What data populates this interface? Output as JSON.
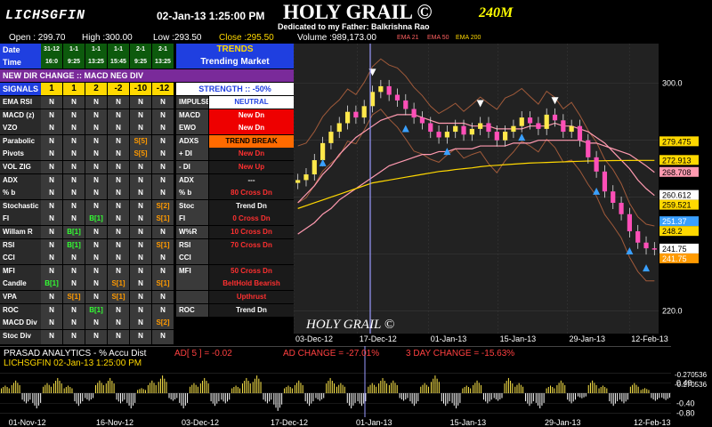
{
  "header": {
    "ticker": "LICHSGFIN",
    "datetime": "02-Jan-13 1:25:00 PM",
    "brand": "HOLY GRAIL ©",
    "timeframe": "240M",
    "dedication": "Dedicated to my Father: Balkrishna Rao"
  },
  "ohlc": {
    "open": "Open : 299.70",
    "high": "High :300.00",
    "low": "Low :293.50",
    "close": "Close :295.50",
    "volume": "Volume :989,173.00",
    "ema21": "EMA 21",
    "ema50": "EMA 50",
    "ema200": "EMA 200"
  },
  "panel": {
    "date_label": "Date",
    "time_label": "Time",
    "dates": [
      "31-12",
      "1-1",
      "1-1",
      "1-1",
      "2-1",
      "2-1"
    ],
    "times": [
      "16:0",
      "9:25",
      "13:25",
      "15:45",
      "9:25",
      "13:25"
    ],
    "trends_label": "TRENDS",
    "trend_status": "Trending Market",
    "dir_change": "NEW DIR CHANGE :: MACD NEG DIV",
    "signals_label": "SIGNALS",
    "signal_cols": [
      "1",
      "1",
      "2",
      "-2",
      "-10",
      "-12"
    ],
    "strength": "STRENGTH :: -50%",
    "rows": [
      {
        "name": "EMA RSI",
        "vals": [
          "N",
          "N",
          "N",
          "N",
          "N",
          "N"
        ]
      },
      {
        "name": "MACD (z)",
        "vals": [
          "N",
          "N",
          "N",
          "N",
          "N",
          "N"
        ]
      },
      {
        "name": "VZO",
        "vals": [
          "N",
          "N",
          "N",
          "N",
          "N",
          "N"
        ]
      },
      {
        "name": "Parabolic",
        "vals": [
          "N",
          "N",
          "N",
          "N",
          "S[5]",
          "N"
        ]
      },
      {
        "name": "Pivots",
        "vals": [
          "N",
          "N",
          "N",
          "N",
          "S[5]",
          "N"
        ]
      },
      {
        "name": "VOL ZIG",
        "vals": [
          "N",
          "N",
          "N",
          "N",
          "N",
          "N"
        ]
      },
      {
        "name": "ADX",
        "vals": [
          "N",
          "N",
          "N",
          "N",
          "N",
          "N"
        ]
      },
      {
        "name": "% b",
        "vals": [
          "N",
          "N",
          "N",
          "N",
          "N",
          "N"
        ]
      },
      {
        "name": "Stochastic",
        "vals": [
          "N",
          "N",
          "N",
          "N",
          "N",
          "S[2]"
        ]
      },
      {
        "name": "FI",
        "vals": [
          "N",
          "N",
          "B[1]",
          "N",
          "N",
          "S[1]"
        ]
      },
      {
        "name": "Willam R",
        "vals": [
          "N",
          "B[1]",
          "N",
          "N",
          "N",
          "N"
        ]
      },
      {
        "name": "RSI",
        "vals": [
          "N",
          "B[1]",
          "N",
          "N",
          "N",
          "S[1]"
        ]
      },
      {
        "name": "CCI",
        "vals": [
          "N",
          "N",
          "N",
          "N",
          "N",
          "N"
        ]
      },
      {
        "name": "MFI",
        "vals": [
          "N",
          "N",
          "N",
          "N",
          "N",
          "N"
        ]
      },
      {
        "name": "Candle",
        "vals": [
          "B[1]",
          "N",
          "N",
          "S[1]",
          "N",
          "S[1]"
        ]
      },
      {
        "name": "VPA",
        "vals": [
          "N",
          "S[1]",
          "N",
          "S[1]",
          "N",
          "N"
        ]
      },
      {
        "name": "ROC",
        "vals": [
          "N",
          "N",
          "B[1]",
          "N",
          "N",
          "N"
        ]
      },
      {
        "name": "MACD Div",
        "vals": [
          "N",
          "N",
          "N",
          "N",
          "N",
          "S[2]"
        ]
      },
      {
        "name": "Stoc Div",
        "vals": [
          "N",
          "N",
          "N",
          "N",
          "N",
          "N"
        ]
      },
      {
        "name": "RSI Div",
        "vals": [
          "N",
          "N",
          "N",
          "N",
          "N",
          "N"
        ]
      }
    ],
    "ind": [
      {
        "name": "IMPULSE",
        "val": "NEUTRAL",
        "style": "whitebg"
      },
      {
        "name": "MACD",
        "val": "New Dn",
        "style": "red"
      },
      {
        "name": "EWO",
        "val": "New Dn",
        "style": "red"
      },
      {
        "name": "ADXS",
        "val": "TREND BREAK",
        "style": "orange"
      },
      {
        "name": "+ DI",
        "val": "New Dn",
        "style": "redtxt"
      },
      {
        "name": "- DI",
        "val": "New Up",
        "style": "redtxt"
      },
      {
        "name": "ADX",
        "val": "---",
        "style": "plain"
      },
      {
        "name": "% b",
        "val": "80 Cross Dn",
        "style": "redtxt"
      },
      {
        "name": "Stoc",
        "val": "Trend Dn",
        "style": "plain"
      },
      {
        "name": "FI",
        "val": "0 Cross Dn",
        "style": "redtxt"
      },
      {
        "name": "W%R",
        "val": "10 Cross Dn",
        "style": "redtxt"
      },
      {
        "name": "RSI",
        "val": "70 Cross Dn",
        "style": "redtxt"
      },
      {
        "name": "CCI",
        "val": "",
        "style": "plain"
      },
      {
        "name": "MFI",
        "val": "50 Cross Dn",
        "style": "redtxt"
      },
      {
        "name": "",
        "val": "BeltHold Bearish",
        "style": "redtxt"
      },
      {
        "name": "",
        "val": "Upthrust",
        "style": "redtxt"
      },
      {
        "name": "ROC",
        "val": "Trend Dn",
        "style": "plain"
      }
    ]
  },
  "chart_data": [
    {
      "type": "line",
      "title": "HOLY GRAIL ©",
      "x_ticks": [
        "03-Dec-12",
        "17-Dec-12",
        "01-Jan-13",
        "15-Jan-13",
        "29-Jan-13",
        "12-Feb-13"
      ],
      "y_ticks": [
        300.0,
        280.0,
        260.0,
        240.0,
        220.0
      ],
      "ylim": [
        212,
        314
      ],
      "price_labels": [
        {
          "value": 279.475,
          "color": "#ffd800"
        },
        {
          "value": 272.913,
          "color": "#ffd800"
        },
        {
          "value": 268.708,
          "color": "#ff9ab0"
        },
        {
          "value": 260.612,
          "color": "#ffffff"
        },
        {
          "value": 259.521,
          "color": "#ffd800"
        },
        {
          "value": 251.37,
          "color": "#3aa0ff"
        },
        {
          "value": 248.2,
          "color": "#ffd800"
        },
        {
          "value": 241.75,
          "color": "#ffffff"
        },
        {
          "value": 241.75,
          "color": "#ff9a00"
        }
      ],
      "series": [
        {
          "name": "Close",
          "color": "#ffffff",
          "values": [
            266,
            268,
            273,
            279,
            283,
            286,
            290,
            288,
            292,
            297,
            299,
            296,
            294,
            291,
            288,
            286,
            283,
            281,
            283,
            285,
            282,
            284,
            286,
            283,
            280,
            283,
            285,
            288,
            286,
            284,
            289,
            287,
            283,
            285,
            280,
            274,
            269,
            262,
            258,
            254,
            248,
            244,
            242,
            241.75
          ]
        },
        {
          "name": "EMA 21",
          "color": "#ff9ab0",
          "values": [
            258,
            261,
            264,
            268,
            271,
            275,
            278,
            281,
            283,
            285,
            287,
            288,
            289,
            289,
            289,
            288,
            287,
            286,
            286,
            286,
            286,
            285,
            285,
            285,
            284,
            284,
            284,
            284,
            285,
            285,
            285,
            286,
            285,
            285,
            284,
            283,
            281,
            279,
            276,
            273,
            270,
            266,
            263,
            260.6
          ]
        },
        {
          "name": "EMA 50",
          "color": "#ff9ab0",
          "values": [
            247,
            249,
            251,
            254,
            256,
            259,
            261,
            263,
            265,
            267,
            269,
            271,
            272,
            273,
            274,
            275,
            275,
            276,
            276,
            277,
            277,
            277,
            278,
            278,
            278,
            278,
            279,
            279,
            279,
            280,
            280,
            280,
            280,
            280,
            280,
            279,
            279,
            278,
            277,
            276,
            275,
            273,
            271,
            268.7
          ]
        },
        {
          "name": "EMA 200",
          "color": "#ffd800",
          "values": [
            256,
            257,
            258,
            259,
            260,
            261,
            262,
            263,
            264,
            265,
            265.5,
            266,
            266.5,
            267,
            267.5,
            268,
            268.5,
            269,
            269.3,
            269.7,
            270,
            270.3,
            270.7,
            271,
            271.2,
            271.4,
            271.6,
            271.8,
            272,
            272.1,
            272.2,
            272.3,
            272.4,
            272.5,
            272.6,
            272.7,
            272.75,
            272.8,
            272.85,
            272.88,
            272.9,
            272.91,
            272.91,
            272.913
          ]
        }
      ]
    },
    {
      "type": "bar",
      "title": "PRASAD ANALYTICS - % Accu Dist",
      "subtitle": "LICHSGFIN  02-Jan-13 1:25:00 PM",
      "x_ticks": [
        "01-Nov-12",
        "16-Nov-12",
        "03-Dec-12",
        "17-Dec-12",
        "01-Jan-13",
        "15-Jan-13",
        "29-Jan-13",
        "12-Feb-13"
      ],
      "y_ticks": [
        0.8,
        0.4,
        -0.4,
        -0.8
      ],
      "ylim": [
        -0.95,
        0.95
      ],
      "annotations": [
        "AD[ 5 ] = -0.02",
        "AD CHANGE = -27.01%",
        "3 DAY CHANGE = -15.63%"
      ],
      "right_labels": [
        "-0.270536",
        "-0.270536"
      ],
      "values": [
        0.3,
        0.5,
        -0.4,
        -0.6,
        0.4,
        0.6,
        0.3,
        -0.5,
        -0.3,
        0.5,
        0.6,
        -0.4,
        -0.6,
        0.2,
        0.5,
        0.7,
        -0.3,
        -0.6,
        0.4,
        0.6,
        -0.5,
        -0.4,
        0.3,
        0.6,
        0.7,
        -0.4,
        -0.7,
        0.3,
        0.5,
        -0.5,
        -0.3,
        0.6,
        0.4,
        -0.6,
        -0.5,
        0.4,
        0.6,
        0.5,
        -0.3,
        -0.5,
        0.4,
        0.7,
        -0.5,
        -0.6,
        0.3,
        0.5,
        -0.4,
        -0.3,
        0.6,
        0.4,
        -0.5,
        -0.6,
        0.3,
        0.5,
        -0.4,
        -0.2,
        0.5,
        0.3,
        -0.5,
        -0.4,
        0.4,
        0.2,
        -0.3,
        -0.27
      ]
    }
  ]
}
